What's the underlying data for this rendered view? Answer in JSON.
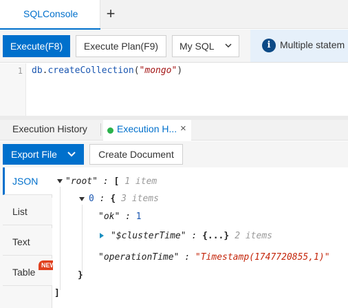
{
  "tabs": {
    "active_label": "SQLConsole",
    "add_label": "+"
  },
  "toolbar": {
    "execute_label": "Execute(F8)",
    "plan_label": "Execute Plan(F9)",
    "db_type": "My SQL",
    "notice_icon": "i",
    "notice_text": "Multiple statem"
  },
  "editor": {
    "line_number": "1",
    "code_object": "db",
    "code_dot": ".",
    "code_function": "createCollection",
    "code_open": "(",
    "code_string": "\"mongo\"",
    "code_close": ")"
  },
  "result_tabs": {
    "history_label": "Execution History",
    "active_label": "Execution H...",
    "close_label": "×"
  },
  "result_toolbar": {
    "export_label": "Export File",
    "create_label": "Create Document"
  },
  "view_tabs": [
    {
      "label": "JSON",
      "active": true
    },
    {
      "label": "List",
      "active": false
    },
    {
      "label": "Text",
      "active": false
    },
    {
      "label": "Table",
      "active": false,
      "badge": "NEW"
    }
  ],
  "tree": {
    "root_key": "\"root\"",
    "colon": " : ",
    "open_array": "[",
    "root_hint": "1 item",
    "item0_key": "0",
    "open_obj": "{",
    "item0_hint": "3 items",
    "ok_key": "\"ok\"",
    "ok_value": "1",
    "cluster_key": "\"$clusterTime\"",
    "cluster_value": "{...}",
    "cluster_hint": "2 items",
    "optime_key": "\"operationTime\"",
    "optime_value": "\"Timestamp(1747720855,1)\"",
    "close_obj": "}",
    "close_array": "]"
  },
  "colors": {
    "primary": "#0070cc",
    "success_dot": "#2bb24c",
    "badge": "#e0401e",
    "string_value": "#c4260b"
  }
}
